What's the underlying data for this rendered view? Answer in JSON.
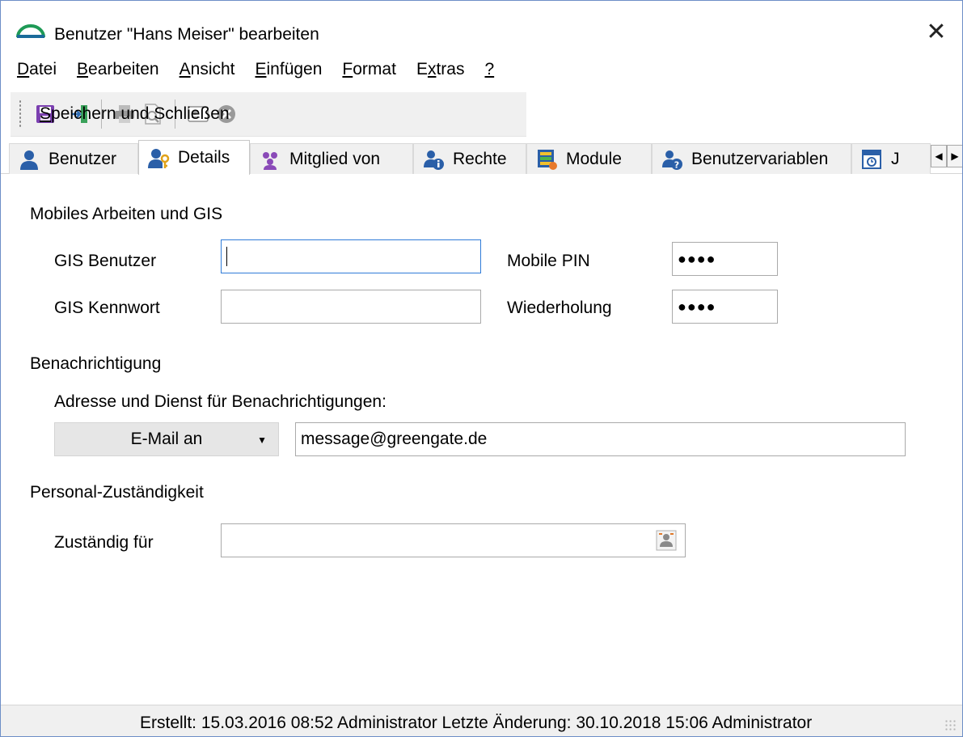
{
  "window": {
    "title": "Benutzer \"Hans Meiser\" bearbeiten",
    "close_glyph": "✕"
  },
  "menu": [
    {
      "pre": "",
      "key": "D",
      "post": "atei"
    },
    {
      "pre": "",
      "key": "B",
      "post": "earbeiten"
    },
    {
      "pre": "",
      "key": "A",
      "post": "nsicht"
    },
    {
      "pre": "",
      "key": "E",
      "post": "infügen"
    },
    {
      "pre": "",
      "key": "F",
      "post": "ormat"
    },
    {
      "pre": "E",
      "key": "x",
      "post": "tras"
    },
    {
      "pre": "",
      "key": "?",
      "post": ""
    }
  ],
  "toolbar": {
    "save_close_key": "S",
    "save_close_rest": "peichern und Schließen",
    "icons": [
      "save-icon",
      "exit-icon",
      "print-icon",
      "print-preview-icon",
      "card-icon",
      "cancel-icon"
    ]
  },
  "tabs": [
    {
      "label": "Benutzer",
      "icon": "user-icon"
    },
    {
      "label": "Details",
      "icon": "user-key-icon"
    },
    {
      "label": "Mitglied von",
      "icon": "group-icon"
    },
    {
      "label": "Rechte",
      "icon": "user-rights-icon"
    },
    {
      "label": "Module",
      "icon": "modules-icon"
    },
    {
      "label": "Benutzervariablen",
      "icon": "user-variables-icon"
    },
    {
      "label": "J",
      "icon": "schedule-icon"
    }
  ],
  "active_tab": "Details",
  "sections": {
    "mobile": {
      "heading": "Mobiles Arbeiten und GIS",
      "gis_user_label": "GIS Benutzer",
      "gis_user_value": "",
      "gis_password_label": "GIS Kennwort",
      "gis_password_value": "",
      "pin_label": "Mobile PIN",
      "pin_value": "●●●●",
      "repeat_label": "Wiederholung",
      "repeat_value": "●●●●"
    },
    "notify": {
      "heading": "Benachrichtigung",
      "hint": "Adresse und Dienst für Benachrichtigungen:",
      "service_selected": "E-Mail an",
      "address_value": "message@greengate.de"
    },
    "staff": {
      "heading": "Personal-Zuständigkeit",
      "responsible_label": "Zuständig für",
      "responsible_value": ""
    }
  },
  "status": {
    "text": "Erstellt: 15.03.2016 08:52 Administrator  Letzte Änderung: 30.10.2018 15:06 Administrator"
  },
  "colors": {
    "accent_blue": "#2f7bd8",
    "app_icon_green": "#1e9a56",
    "toolbar_bg": "#f0f0f0",
    "save_purple": "#7b3fb0"
  }
}
